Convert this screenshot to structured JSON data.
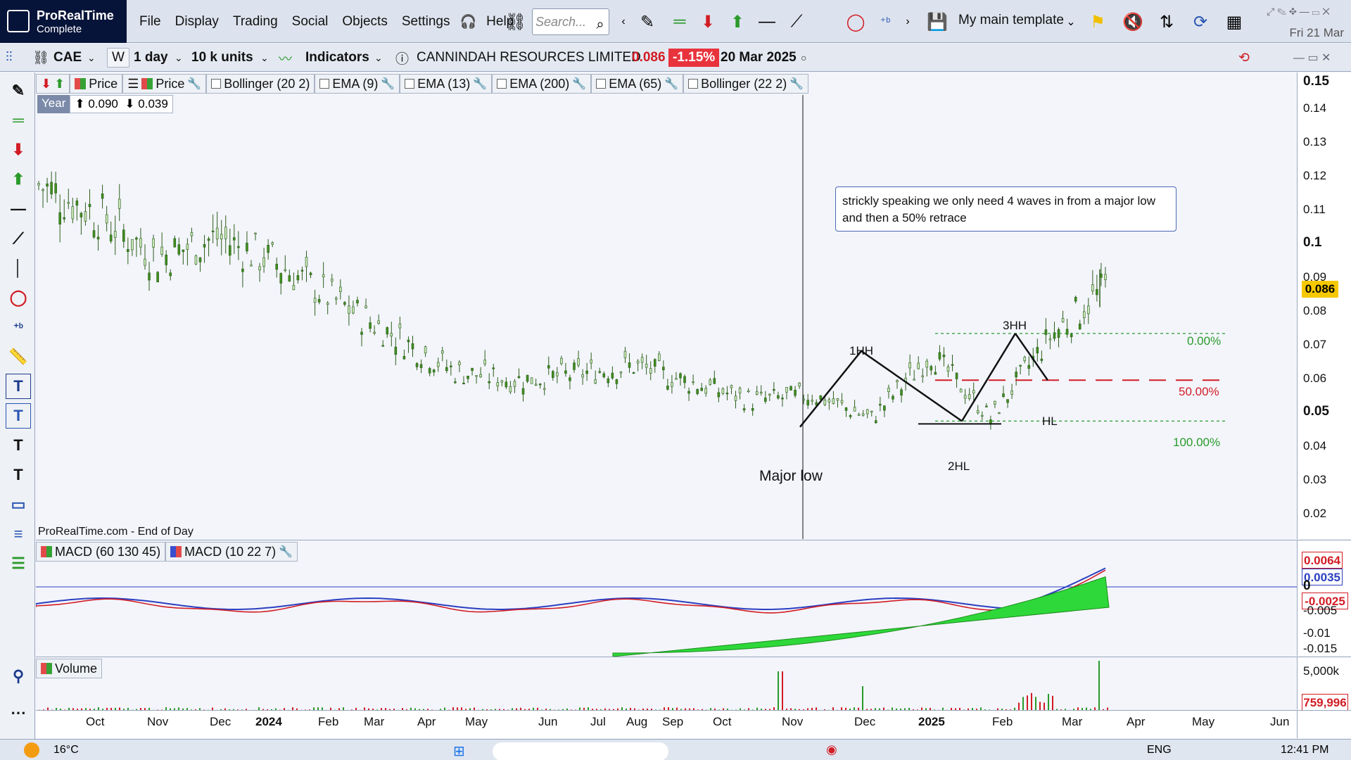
{
  "app": {
    "brand": "ProRealTime",
    "edition": "Complete",
    "menu": [
      "File",
      "Display",
      "Trading",
      "Social",
      "Objects",
      "Settings",
      "Help"
    ],
    "search_placeholder": "Search...",
    "template": "My main template",
    "date": "Fri 21 Mar"
  },
  "toolbar2": {
    "ticker": "CAE",
    "w_label": "W",
    "timeframe": "1 day",
    "units": "10 k units",
    "indicators": "Indicators",
    "instrument": "CANNINDAH RESOURCES LIMITED",
    "last": "0.086",
    "change": "-1.15%",
    "date": "20 Mar 2025"
  },
  "price_pane": {
    "indicators": [
      {
        "label": "Price"
      },
      {
        "label": "Price"
      },
      {
        "label": "Bollinger (20 2)"
      },
      {
        "label": "EMA (9)"
      },
      {
        "label": "EMA (13)"
      },
      {
        "label": "EMA (200)"
      },
      {
        "label": "EMA (65)"
      },
      {
        "label": "Bollinger (22 2)"
      }
    ],
    "range_label": "Year",
    "high": "0.090",
    "low": "0.039",
    "source": "ProRealTime.com - End of Day",
    "note": "strickly speaking we only need 4 waves in from a major low and then a 50% retrace",
    "labels": {
      "major_low": "Major low",
      "w1": "1HH",
      "w2": "2HL",
      "w3": "3HH",
      "w4": "HL"
    },
    "fib": {
      "f0": "0.00%",
      "f50": "50.00%",
      "f100": "100.00%"
    },
    "last_price": "0.086",
    "y_ticks": [
      "0.15",
      "0.14",
      "0.13",
      "0.12",
      "0.11",
      "0.1",
      "0.09",
      "0.08",
      "0.07",
      "0.06",
      "0.05",
      "0.04",
      "0.03",
      "0.02"
    ]
  },
  "macd_pane": {
    "indicators": [
      {
        "label": "MACD (60 130 45)"
      },
      {
        "label": "MACD (10 22 7)"
      }
    ],
    "tag_red": "0.0064",
    "tag_blue": "0.0035",
    "tag_neg": "-0.0025",
    "y_ticks": [
      "0",
      "-0.005",
      "-0.01",
      "-0.015"
    ]
  },
  "volume_pane": {
    "label": "Volume",
    "tick": "5,000k",
    "tag": "759,996"
  },
  "x_axis": [
    "Oct",
    "Nov",
    "Dec",
    "2024",
    "Feb",
    "Mar",
    "Apr",
    "May",
    "Jun",
    "Jul",
    "Aug",
    "Sep",
    "Oct",
    "Nov",
    "Dec",
    "2025",
    "Feb",
    "Mar",
    "Apr",
    "May",
    "Jun"
  ],
  "taskbar": {
    "weather": "16°C",
    "lang": "ENG",
    "time": "12:41 PM"
  },
  "chart_data": {
    "type": "candlestick",
    "instrument": "CANNINDAH RESOURCES LIMITED",
    "ticker": "CAE",
    "timeframe": "1 day",
    "ylim": [
      0.015,
      0.155
    ],
    "approx_closes": [
      {
        "x": "Sep 2023",
        "y": 0.12
      },
      {
        "x": "Oct 2023",
        "y": 0.11
      },
      {
        "x": "Nov 2023",
        "y": 0.095
      },
      {
        "x": "Dec 2023",
        "y": 0.102
      },
      {
        "x": "Jan 2024",
        "y": 0.093
      },
      {
        "x": "Feb 2024",
        "y": 0.08
      },
      {
        "x": "Mar 2024",
        "y": 0.068
      },
      {
        "x": "Apr 2024",
        "y": 0.056
      },
      {
        "x": "May 2024",
        "y": 0.053
      },
      {
        "x": "Jun 2024",
        "y": 0.055
      },
      {
        "x": "Jul 2024",
        "y": 0.058
      },
      {
        "x": "Aug 2024",
        "y": 0.052
      },
      {
        "x": "Sep 2024",
        "y": 0.046
      },
      {
        "x": "Oct 2024",
        "y": 0.048
      },
      {
        "x": "Nov 2024",
        "y": 0.04
      },
      {
        "x": "Dec 2024",
        "y": 0.062
      },
      {
        "x": "Jan 2025",
        "y": 0.04
      },
      {
        "x": "Feb 2025",
        "y": 0.068
      },
      {
        "x": "Mar 2025",
        "y": 0.086
      }
    ],
    "wave_points": [
      {
        "label": "Major low",
        "x": "Nov 2024",
        "y": 0.037
      },
      {
        "label": "1HH",
        "x": "Dec 2024",
        "y": 0.063
      },
      {
        "label": "2HL",
        "x": "Jan 2025",
        "y": 0.039
      },
      {
        "label": "3HH",
        "x": "Feb 2025",
        "y": 0.069
      },
      {
        "label": "HL",
        "x": "Feb 2025",
        "y": 0.053
      }
    ],
    "fib_levels": [
      {
        "label": "0.00%",
        "y": 0.069
      },
      {
        "label": "50.00%",
        "y": 0.053
      },
      {
        "label": "100.00%",
        "y": 0.039
      }
    ]
  }
}
